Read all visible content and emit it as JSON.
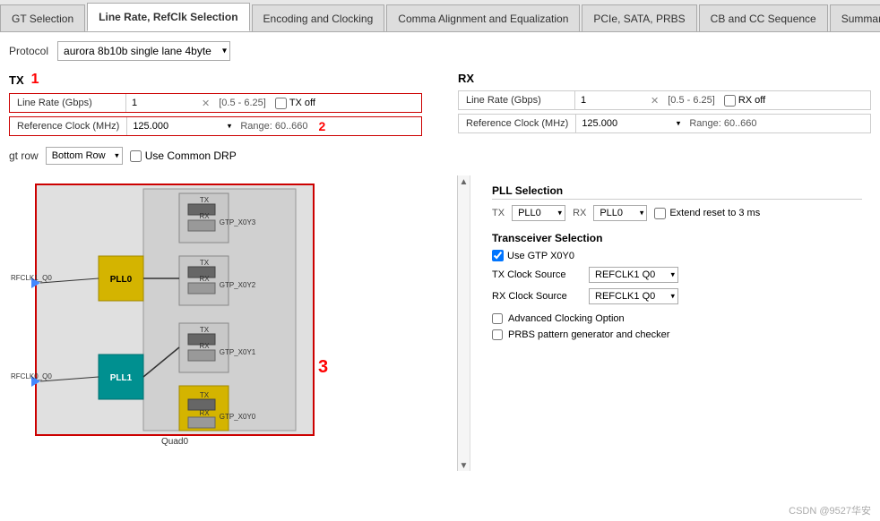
{
  "tabs": [
    {
      "label": "GT Selection",
      "active": false
    },
    {
      "label": "Line Rate, RefClk Selection",
      "active": true
    },
    {
      "label": "Encoding and Clocking",
      "active": false
    },
    {
      "label": "Comma Alignment and Equalization",
      "active": false
    },
    {
      "label": "PCIe, SATA, PRBS",
      "active": false
    },
    {
      "label": "CB and CC Sequence",
      "active": false
    },
    {
      "label": "Summary",
      "active": false
    }
  ],
  "protocol": {
    "label": "Protocol",
    "value": "aurora 8b10b single lane 4byte"
  },
  "tx": {
    "header": "TX",
    "number": "1",
    "line_rate": {
      "label": "Line Rate (Gbps)",
      "value": "1",
      "range": "[0.5 - 6.25]",
      "off_label": "TX off"
    },
    "ref_clock": {
      "label": "Reference Clock (MHz)",
      "value": "125.000",
      "range": "Range: 60..660",
      "number": "2"
    }
  },
  "rx": {
    "header": "RX",
    "line_rate": {
      "label": "Line Rate (Gbps)",
      "value": "1",
      "range": "[0.5 - 6.25]",
      "off_label": "RX off"
    },
    "ref_clock": {
      "label": "Reference Clock (MHz)",
      "value": "125.000",
      "range": "Range: 60..660"
    }
  },
  "gt_row": {
    "label": "gt row",
    "value": "Bottom Row",
    "drp_label": "Use Common DRP"
  },
  "diagram": {
    "number": "3",
    "quad_label": "Quad0",
    "gtp_labels": [
      "GTP_X0Y3",
      "GTP_X0Y2",
      "GTP_X0Y1",
      "GTP_X0Y0"
    ],
    "pll_labels": [
      "PLL0",
      "PLL1"
    ],
    "refclk_labels": [
      "RFCLK1_Q0",
      "RFCLK0_Q0"
    ]
  },
  "pll_section": {
    "title": "PLL Selection",
    "tx_label": "TX",
    "tx_value": "PLL0",
    "rx_label": "RX",
    "rx_value": "PLL0",
    "extend_label": "Extend reset to 3 ms"
  },
  "transceiver_section": {
    "title": "Transceiver Selection",
    "use_gtp_label": "Use GTP X0Y0",
    "tx_clock_label": "TX Clock Source",
    "tx_clock_value": "REFCLK1 Q0",
    "rx_clock_label": "RX Clock Source",
    "rx_clock_value": "REFCLK1 Q0"
  },
  "options": [
    {
      "label": "Advanced Clocking Option",
      "checked": false
    },
    {
      "label": "PRBS pattern generator and checker",
      "checked": false
    }
  ],
  "watermark": "CSDN @9527华安"
}
